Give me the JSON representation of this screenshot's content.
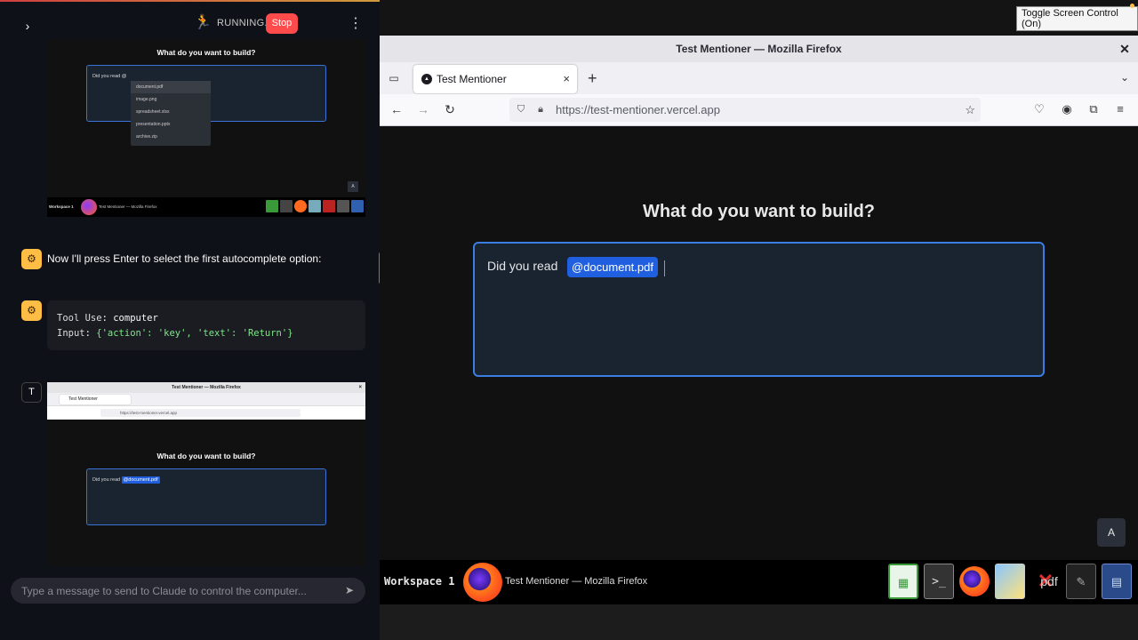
{
  "chat": {
    "status": "RUNNING...",
    "stop_label": "Stop",
    "message1": "Now I'll press Enter to select the first autocomplete option:",
    "tool_use_key": "Tool Use",
    "tool_use_value": "computer",
    "input_key": "Input",
    "input_value": "{'action': 'key', 'text': 'Return'}",
    "user_initial": "T",
    "placeholder": "Type a message to send to Claude to control the computer..."
  },
  "thumb1": {
    "heading": "What do you want to build?",
    "input_text": "Did you read @",
    "options": [
      "document.pdf",
      "image.png",
      "spreadsheet.xlsx",
      "presentation.pptx",
      "archive.zip"
    ],
    "button": "A",
    "workspace": "Workspace 1",
    "task_title": "Test Mentioner — Mozilla Firefox"
  },
  "thumb2": {
    "window_title": "Test Mentioner — Mozilla Firefox",
    "tab_label": "Test Mentioner",
    "url": "https://test-mentioner.vercel.app",
    "heading": "What do you want to build?",
    "input_text": "Did you read",
    "mention": "@document.pdf"
  },
  "desktop": {
    "toggle_label": "Toggle Screen Control (On)",
    "window_title": "Test Mentioner — Mozilla Firefox",
    "tab_label": "Test Mentioner",
    "url": "https://test-mentioner.vercel.app",
    "heading": "What do you want to build?",
    "input_text": "Did you read",
    "mention": "@document.pdf",
    "fab_label": "A",
    "workspace": "Workspace 1",
    "task_title": "Test Mentioner — Mozilla Firefox",
    "pdf_label": "pdf"
  },
  "colors": {
    "stop": "#ff4b4b",
    "bot_avatar": "#ffbd45",
    "mention": "#1f5fe0",
    "editor_border": "#3b7de0"
  }
}
